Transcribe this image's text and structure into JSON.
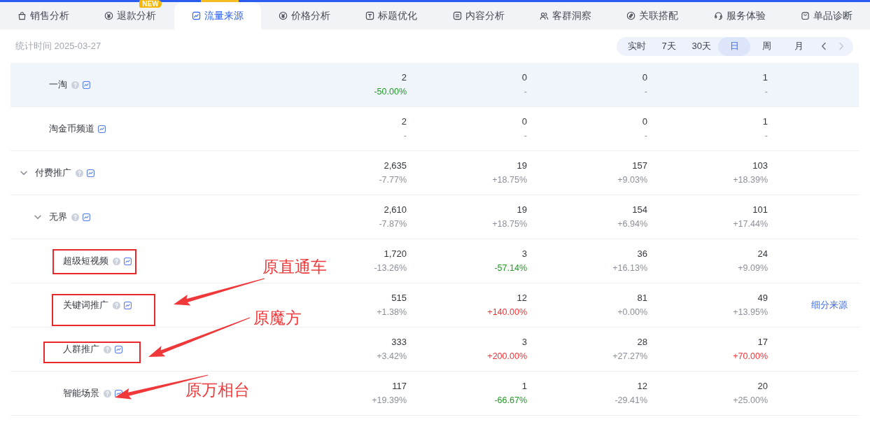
{
  "tabs": [
    {
      "label": "销售分析",
      "selected": false
    },
    {
      "label": "退款分析",
      "selected": false,
      "badge": "NEW"
    },
    {
      "label": "流量来源",
      "selected": true
    },
    {
      "label": "价格分析",
      "selected": false
    },
    {
      "label": "标题优化",
      "selected": false
    },
    {
      "label": "内容分析",
      "selected": false
    },
    {
      "label": "客群洞察",
      "selected": false
    },
    {
      "label": "关联搭配",
      "selected": false
    },
    {
      "label": "服务体验",
      "selected": false
    },
    {
      "label": "单品诊断",
      "selected": false
    }
  ],
  "toolbar": {
    "stat_time": "统计时间 2025-03-27",
    "periods": [
      {
        "label": "实时",
        "selected": false
      },
      {
        "label": "7天",
        "selected": false
      },
      {
        "label": "30天",
        "selected": false
      },
      {
        "label": "日",
        "selected": true
      },
      {
        "label": "周",
        "selected": false
      },
      {
        "label": "月",
        "selected": false
      }
    ],
    "prev": {
      "disabled": false
    },
    "next": {
      "disabled": true
    }
  },
  "table": {
    "rows": [
      {
        "children": [
          {
            "label": "一淘",
            "help": true,
            "hovered": true,
            "boxed": false,
            "cells": [
              {
                "value": "2",
                "change": "-50.00%",
                "color": "#1e9a23"
              },
              {
                "value": "0",
                "change": "-"
              },
              {
                "value": "0",
                "change": "-"
              },
              {
                "value": "1",
                "change": "-"
              }
            ]
          },
          {
            "label": "淘金币频道",
            "help": false,
            "hovered": false,
            "boxed": false,
            "cells": [
              {
                "value": "2",
                "change": "-"
              },
              {
                "value": "0",
                "change": "-"
              },
              {
                "value": "0",
                "change": "-"
              },
              {
                "value": "1",
                "change": "-"
              }
            ]
          }
        ]
      },
      {
        "label": "付费推广",
        "expanded": true,
        "help": true,
        "hovered": false,
        "boxed": false,
        "cells": [
          {
            "value": "2,635",
            "change": "-7.77%",
            "color": "#8a8f99"
          },
          {
            "value": "19",
            "change": "+18.75%",
            "color": "#8a8f99"
          },
          {
            "value": "157",
            "change": "+9.03%",
            "color": "#8a8f99"
          },
          {
            "value": "103",
            "change": "+18.39%",
            "color": "#8a8f99"
          }
        ],
        "children": [
          {
            "label": "无界",
            "expanded": true,
            "help": true,
            "hovered": false,
            "boxed": false,
            "cells": [
              {
                "value": "2,610",
                "change": "-7.87%",
                "color": "#8a8f99"
              },
              {
                "value": "19",
                "change": "+18.75%",
                "color": "#8a8f99"
              },
              {
                "value": "154",
                "change": "+6.94%",
                "color": "#8a8f99"
              },
              {
                "value": "101",
                "change": "+17.44%",
                "color": "#8a8f99"
              }
            ],
            "children": [
              {
                "label": "超级短视频",
                "help": true,
                "hovered": false,
                "boxed": true,
                "cells": [
                  {
                    "value": "1,720",
                    "change": "-13.26%",
                    "color": "#8a8f99"
                  },
                  {
                    "value": "3",
                    "change": "-57.14%",
                    "color": "#1e9a23"
                  },
                  {
                    "value": "36",
                    "change": "+16.13%",
                    "color": "#8a8f99"
                  },
                  {
                    "value": "24",
                    "change": "+9.09%",
                    "color": "#8a8f99"
                  }
                ]
              },
              {
                "label": "关键词推广",
                "help": true,
                "hovered": false,
                "boxed": true,
                "action": "细分来源",
                "cells": [
                  {
                    "value": "515",
                    "change": "+1.38%",
                    "color": "#8a8f99"
                  },
                  {
                    "value": "12",
                    "change": "+140.00%",
                    "color": "#f53036"
                  },
                  {
                    "value": "81",
                    "change": "+0.00%",
                    "color": "#8a8f99"
                  },
                  {
                    "value": "49",
                    "change": "+13.95%",
                    "color": "#8a8f99"
                  }
                ]
              },
              {
                "label": "人群推广",
                "help": true,
                "hovered": false,
                "boxed": true,
                "cells": [
                  {
                    "value": "333",
                    "change": "+3.42%",
                    "color": "#8a8f99"
                  },
                  {
                    "value": "3",
                    "change": "+200.00%",
                    "color": "#f53036"
                  },
                  {
                    "value": "28",
                    "change": "+27.27%",
                    "color": "#8a8f99"
                  },
                  {
                    "value": "17",
                    "change": "+70.00%",
                    "color": "#f53036"
                  }
                ]
              },
              {
                "label": "智能场景",
                "help": true,
                "hovered": false,
                "boxed": false,
                "cells": [
                  {
                    "value": "117",
                    "change": "+19.39%",
                    "color": "#8a8f99"
                  },
                  {
                    "value": "1",
                    "change": "-66.67%",
                    "color": "#1e9a23"
                  },
                  {
                    "value": "12",
                    "change": "-29.41%",
                    "color": "#8a8f99"
                  },
                  {
                    "value": "20",
                    "change": "+25.00%",
                    "color": "#8a8f99"
                  }
                ]
              }
            ]
          }
        ]
      }
    ]
  },
  "callouts": [
    {
      "text": "原直通车"
    },
    {
      "text": "原魔方"
    },
    {
      "text": "原万相台"
    }
  ]
}
